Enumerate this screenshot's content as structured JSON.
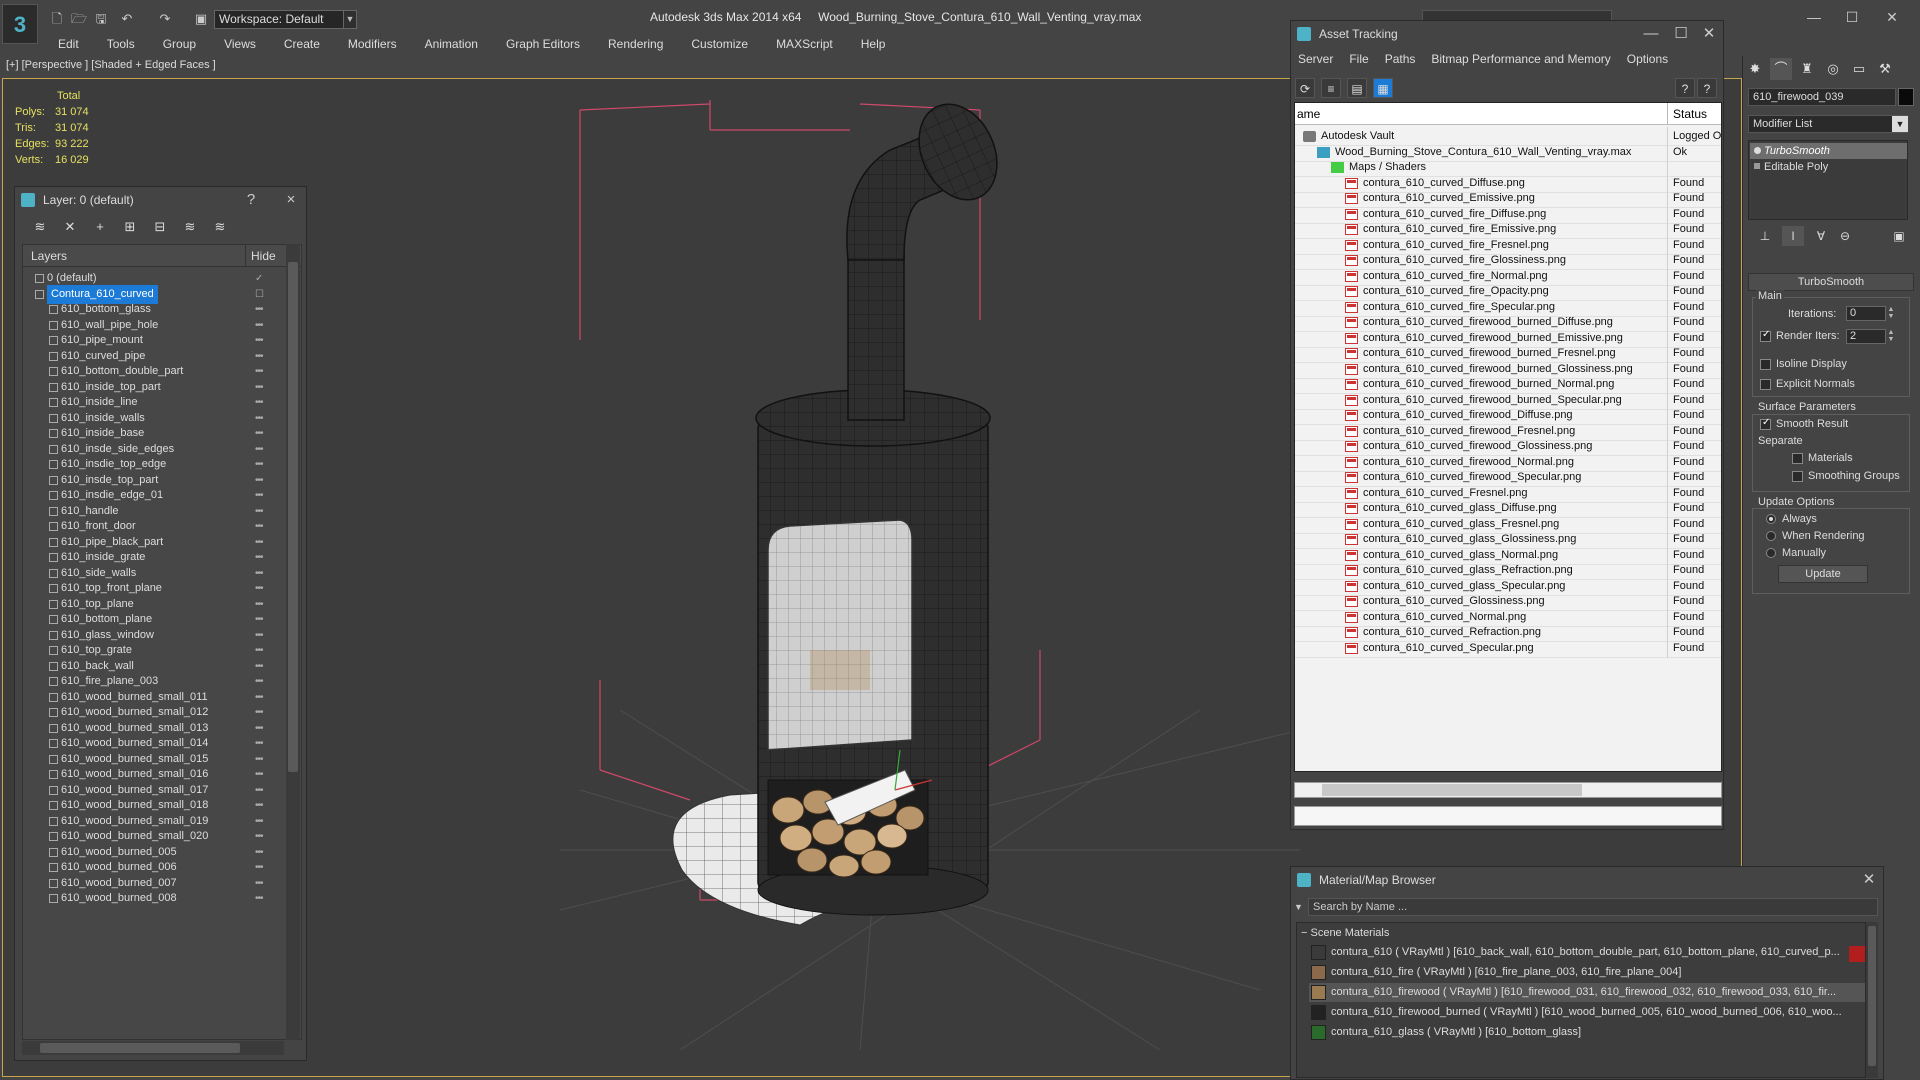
{
  "app": {
    "workspace": "Workspace: Default",
    "title_app": "Autodesk 3ds Max  2014 x64",
    "title_file": "Wood_Burning_Stove_Contura_610_Wall_Venting_vray.max",
    "menu": [
      "Edit",
      "Tools",
      "Group",
      "Views",
      "Create",
      "Modifiers",
      "Animation",
      "Graph Editors",
      "Rendering",
      "Customize",
      "MAXScript",
      "Help"
    ]
  },
  "viewport": {
    "label": "[+] [Perspective ] [Shaded + Edged Faces ]",
    "stats": {
      "header": "Total",
      "rows": [
        {
          "k": "Polys:",
          "v": "31 074"
        },
        {
          "k": "Tris:",
          "v": "31 074"
        },
        {
          "k": "Edges:",
          "v": "93 222"
        },
        {
          "k": "Verts:",
          "v": "16 029"
        }
      ]
    }
  },
  "layer_explorer": {
    "title": "Layer: 0 (default)",
    "help": "?",
    "close": "×",
    "columns": {
      "layers": "Layers",
      "hide": "Hide"
    },
    "rows": [
      {
        "name": "0 (default)",
        "level": 0,
        "active": true
      },
      {
        "name": "Contura_610_curved",
        "level": 0,
        "selected": true
      },
      {
        "name": "610_bottom_glass",
        "level": 1
      },
      {
        "name": "610_wall_pipe_hole",
        "level": 1
      },
      {
        "name": "610_pipe_mount",
        "level": 1
      },
      {
        "name": "610_curved_pipe",
        "level": 1
      },
      {
        "name": "610_bottom_double_part",
        "level": 1
      },
      {
        "name": "610_inside_top_part",
        "level": 1
      },
      {
        "name": "610_inside_line",
        "level": 1
      },
      {
        "name": "610_inside_walls",
        "level": 1
      },
      {
        "name": "610_inside_base",
        "level": 1
      },
      {
        "name": "610_insde_side_edges",
        "level": 1
      },
      {
        "name": "610_insdie_top_edge",
        "level": 1
      },
      {
        "name": "610_insde_top_part",
        "level": 1
      },
      {
        "name": "610_insdie_edge_01",
        "level": 1
      },
      {
        "name": "610_handle",
        "level": 1
      },
      {
        "name": "610_front_door",
        "level": 1
      },
      {
        "name": "610_pipe_black_part",
        "level": 1
      },
      {
        "name": "610_inside_grate",
        "level": 1
      },
      {
        "name": "610_side_walls",
        "level": 1
      },
      {
        "name": "610_top_front_plane",
        "level": 1
      },
      {
        "name": "610_top_plane",
        "level": 1
      },
      {
        "name": "610_bottom_plane",
        "level": 1
      },
      {
        "name": "610_glass_window",
        "level": 1
      },
      {
        "name": "610_top_grate",
        "level": 1
      },
      {
        "name": "610_back_wall",
        "level": 1
      },
      {
        "name": "610_fire_plane_003",
        "level": 1
      },
      {
        "name": "610_wood_burned_small_011",
        "level": 1
      },
      {
        "name": "610_wood_burned_small_012",
        "level": 1
      },
      {
        "name": "610_wood_burned_small_013",
        "level": 1
      },
      {
        "name": "610_wood_burned_small_014",
        "level": 1
      },
      {
        "name": "610_wood_burned_small_015",
        "level": 1
      },
      {
        "name": "610_wood_burned_small_016",
        "level": 1
      },
      {
        "name": "610_wood_burned_small_017",
        "level": 1
      },
      {
        "name": "610_wood_burned_small_018",
        "level": 1
      },
      {
        "name": "610_wood_burned_small_019",
        "level": 1
      },
      {
        "name": "610_wood_burned_small_020",
        "level": 1
      },
      {
        "name": "610_wood_burned_005",
        "level": 1
      },
      {
        "name": "610_wood_burned_006",
        "level": 1
      },
      {
        "name": "610_wood_burned_007",
        "level": 1
      },
      {
        "name": "610_wood_burned_008",
        "level": 1
      }
    ]
  },
  "asset_tracking": {
    "title": "Asset Tracking",
    "menu": [
      "Server",
      "File",
      "Paths",
      "Bitmap Performance and Memory",
      "Options"
    ],
    "columns": {
      "name": "ame",
      "status": "Status"
    },
    "rows": [
      {
        "name": "Autodesk Vault",
        "status": "Logged O",
        "type": "vault",
        "level": 0
      },
      {
        "name": "Wood_Burning_Stove_Contura_610_Wall_Venting_vray.max",
        "status": "Ok",
        "type": "max",
        "level": 1
      },
      {
        "name": "Maps / Shaders",
        "status": "",
        "type": "maps",
        "level": 2
      },
      {
        "name": "contura_610_curved_Diffuse.png",
        "status": "Found",
        "type": "png",
        "level": 3
      },
      {
        "name": "contura_610_curved_Emissive.png",
        "status": "Found",
        "type": "png",
        "level": 3
      },
      {
        "name": "contura_610_curved_fire_Diffuse.png",
        "status": "Found",
        "type": "png",
        "level": 3
      },
      {
        "name": "contura_610_curved_fire_Emissive.png",
        "status": "Found",
        "type": "png",
        "level": 3
      },
      {
        "name": "contura_610_curved_fire_Fresnel.png",
        "status": "Found",
        "type": "png",
        "level": 3
      },
      {
        "name": "contura_610_curved_fire_Glossiness.png",
        "status": "Found",
        "type": "png",
        "level": 3
      },
      {
        "name": "contura_610_curved_fire_Normal.png",
        "status": "Found",
        "type": "png",
        "level": 3
      },
      {
        "name": "contura_610_curved_fire_Opacity.png",
        "status": "Found",
        "type": "png",
        "level": 3
      },
      {
        "name": "contura_610_curved_fire_Specular.png",
        "status": "Found",
        "type": "png",
        "level": 3
      },
      {
        "name": "contura_610_curved_firewood_burned_Diffuse.png",
        "status": "Found",
        "type": "png",
        "level": 3
      },
      {
        "name": "contura_610_curved_firewood_burned_Emissive.png",
        "status": "Found",
        "type": "png",
        "level": 3
      },
      {
        "name": "contura_610_curved_firewood_burned_Fresnel.png",
        "status": "Found",
        "type": "png",
        "level": 3
      },
      {
        "name": "contura_610_curved_firewood_burned_Glossiness.png",
        "status": "Found",
        "type": "png",
        "level": 3
      },
      {
        "name": "contura_610_curved_firewood_burned_Normal.png",
        "status": "Found",
        "type": "png",
        "level": 3
      },
      {
        "name": "contura_610_curved_firewood_burned_Specular.png",
        "status": "Found",
        "type": "png",
        "level": 3
      },
      {
        "name": "contura_610_curved_firewood_Diffuse.png",
        "status": "Found",
        "type": "png",
        "level": 3
      },
      {
        "name": "contura_610_curved_firewood_Fresnel.png",
        "status": "Found",
        "type": "png",
        "level": 3
      },
      {
        "name": "contura_610_curved_firewood_Glossiness.png",
        "status": "Found",
        "type": "png",
        "level": 3
      },
      {
        "name": "contura_610_curved_firewood_Normal.png",
        "status": "Found",
        "type": "png",
        "level": 3
      },
      {
        "name": "contura_610_curved_firewood_Specular.png",
        "status": "Found",
        "type": "png",
        "level": 3
      },
      {
        "name": "contura_610_curved_Fresnel.png",
        "status": "Found",
        "type": "png",
        "level": 3
      },
      {
        "name": "contura_610_curved_glass_Diffuse.png",
        "status": "Found",
        "type": "png",
        "level": 3
      },
      {
        "name": "contura_610_curved_glass_Fresnel.png",
        "status": "Found",
        "type": "png",
        "level": 3
      },
      {
        "name": "contura_610_curved_glass_Glossiness.png",
        "status": "Found",
        "type": "png",
        "level": 3
      },
      {
        "name": "contura_610_curved_glass_Normal.png",
        "status": "Found",
        "type": "png",
        "level": 3
      },
      {
        "name": "contura_610_curved_glass_Refraction.png",
        "status": "Found",
        "type": "png",
        "level": 3
      },
      {
        "name": "contura_610_curved_glass_Specular.png",
        "status": "Found",
        "type": "png",
        "level": 3
      },
      {
        "name": "contura_610_curved_Glossiness.png",
        "status": "Found",
        "type": "png",
        "level": 3
      },
      {
        "name": "contura_610_curved_Normal.png",
        "status": "Found",
        "type": "png",
        "level": 3
      },
      {
        "name": "contura_610_curved_Refraction.png",
        "status": "Found",
        "type": "png",
        "level": 3
      },
      {
        "name": "contura_610_curved_Specular.png",
        "status": "Found",
        "type": "png",
        "level": 3
      }
    ]
  },
  "command_panel": {
    "object_name": "610_firewood_039",
    "modifier_list": "Modifier List",
    "stack": [
      {
        "name": "TurboSmooth",
        "active": true
      },
      {
        "name": "Editable Poly",
        "active": false
      }
    ],
    "turbosmooth": {
      "title": "TurboSmooth",
      "main": "Main",
      "iterations_label": "Iterations:",
      "iterations": "0",
      "render_iters_label": "Render Iters:",
      "render_iters": "2",
      "render_iters_checked": true,
      "isoline": "Isoline Display",
      "explicit_normals": "Explicit Normals",
      "surface_params": "Surface Parameters",
      "smooth_result": "Smooth Result",
      "separate": "Separate",
      "materials": "Materials",
      "smoothing_groups": "Smoothing Groups",
      "update_options": "Update Options",
      "always": "Always",
      "when_rendering": "When Rendering",
      "manually": "Manually",
      "update": "Update"
    }
  },
  "material_browser": {
    "title": "Material/Map Browser",
    "search_placeholder": "Search by Name ...",
    "group": "Scene Materials",
    "rows": [
      {
        "text": "contura_610  ( VRayMtl ) [610_back_wall, 610_bottom_double_part, 610_bottom_plane, 610_curved_p...",
        "swatch": "#3a3a3a",
        "highlight": "red"
      },
      {
        "text": "contura_610_fire  ( VRayMtl ) [610_fire_plane_003, 610_fire_plane_004]",
        "swatch": "#8a6a4a"
      },
      {
        "text": "contura_610_firewood  ( VRayMtl ) [610_firewood_031, 610_firewood_032, 610_firewood_033, 610_fir...",
        "swatch": "#9a7a50",
        "highlight": "grey"
      },
      {
        "text": "contura_610_firewood_burned  ( VRayMtl ) [610_wood_burned_005, 610_wood_burned_006, 610_woo...",
        "swatch": "#222222"
      },
      {
        "text": "contura_610_glass  ( VRayMtl ) [610_bottom_glass]",
        "swatch": "#2a6a2a"
      }
    ]
  },
  "colors": {
    "accent": "#1c7bd6",
    "stats_text": "#e6e060",
    "viewport_border": "#c8a44c",
    "selection_box": "#d04a6a",
    "row_highlight_red": "#b21e1e"
  }
}
